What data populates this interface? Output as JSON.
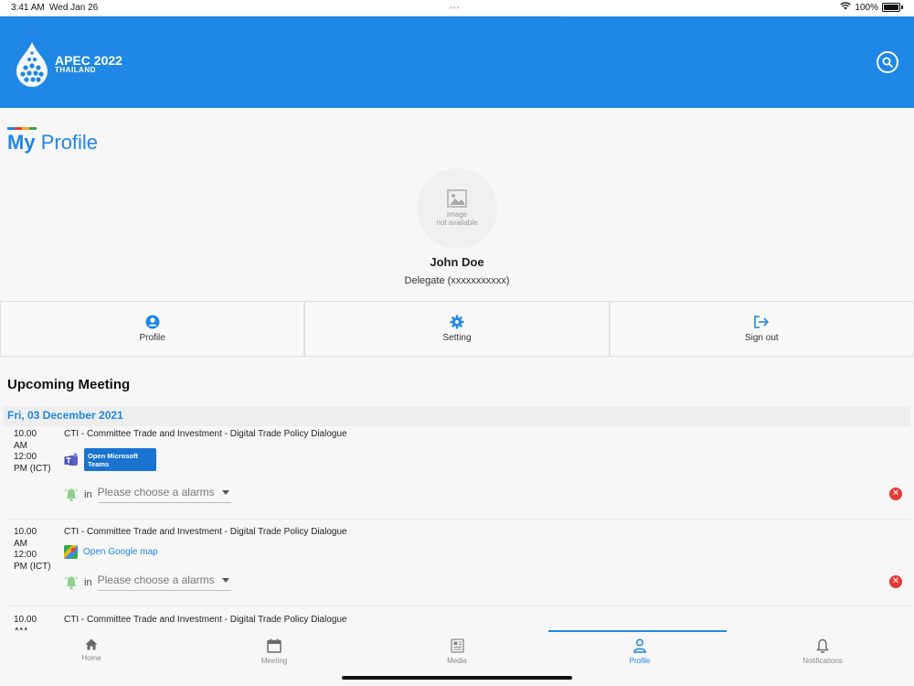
{
  "status_bar": {
    "time": "3:41 AM",
    "date": "Wed Jan 26",
    "battery": "100%"
  },
  "header": {
    "logo_title": "APEC 2022",
    "logo_subtitle": "THAILAND",
    "brand_color": "#1f87e5"
  },
  "page": {
    "title_bold": "My",
    "title_rest": "Profile"
  },
  "profile": {
    "image_placeholder_line1": "Image",
    "image_placeholder_line2": "not available",
    "name": "John Doe",
    "role": "Delegate (xxxxxxxxxxx)"
  },
  "actions": [
    {
      "label": "Profile",
      "icon": "person-circle-icon"
    },
    {
      "label": "Setting",
      "icon": "gear-icon"
    },
    {
      "label": "Sign out",
      "icon": "sign-out-icon"
    }
  ],
  "upcoming": {
    "title": "Upcoming Meeting",
    "date": "Fri, 03 December 2021",
    "meetings": [
      {
        "time_lines": [
          "10.00",
          "AM",
          "12:00",
          "PM (ICT)"
        ],
        "title": "CTI - Committee Trade and Investment - Digital Trade Policy Dialogue",
        "action_label": "Open Microsoft Teams",
        "alarm_in": "in",
        "alarm_placeholder": "Please choose a alarms"
      },
      {
        "time_lines": [
          "10.00",
          "AM",
          "12:00",
          "PM (ICT)"
        ],
        "title": "CTI - Committee Trade and Investment - Digital Trade Policy Dialogue",
        "action_label": "Open Google map",
        "alarm_in": "in",
        "alarm_placeholder": "Please choose a alarms"
      },
      {
        "time_lines": [
          "10.00",
          "AM"
        ],
        "title": "CTI - Committee Trade and Investment - Digital Trade Policy Dialogue"
      }
    ]
  },
  "bottom_nav": [
    {
      "label": "Home",
      "icon": "home-icon"
    },
    {
      "label": "Meeting",
      "icon": "calendar-icon"
    },
    {
      "label": "Media",
      "icon": "newspaper-icon"
    },
    {
      "label": "Profile",
      "icon": "person-icon",
      "active": true
    },
    {
      "label": "Notifications",
      "icon": "bell-icon"
    }
  ]
}
